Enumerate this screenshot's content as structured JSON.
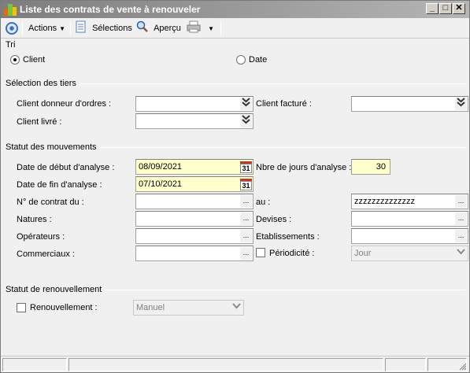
{
  "window": {
    "title": "Liste des contrats de vente à renouveler"
  },
  "window_controls": {
    "minimize": "_",
    "maximize": "□",
    "close": "✕"
  },
  "toolbar": {
    "actions_label": "Actions",
    "selections_label": "Sélections",
    "apercu_label": "Aperçu"
  },
  "tri": {
    "title": "Tri",
    "options": [
      {
        "label": "Client",
        "checked": true
      },
      {
        "label": "Date",
        "checked": false
      }
    ]
  },
  "tiers": {
    "title": "Sélection des tiers",
    "client_donneur_label": "Client donneur d'ordres :",
    "client_donneur_value": "",
    "client_facture_label": "Client facturé :",
    "client_facture_value": "",
    "client_livre_label": "Client livré :",
    "client_livre_value": ""
  },
  "mouvements": {
    "title": "Statut des mouvements",
    "date_debut_label": "Date de début d'analyse :",
    "date_debut_value": "08/09/2021",
    "nbre_jours_label": "Nbre de jours d'analyse :",
    "nbre_jours_value": "30",
    "date_fin_label": "Date de fin d'analyse :",
    "date_fin_value": "07/10/2021",
    "calendar_day": "31",
    "contrat_du_label": "N° de contrat du :",
    "contrat_du_value": "",
    "contrat_au_label": "au :",
    "contrat_au_value": "zzzzzzzzzzzzzz",
    "natures_label": "Natures :",
    "devises_label": "Devises :",
    "operateurs_label": "Opérateurs :",
    "etablissements_label": "Etablissements :",
    "commerciaux_label": "Commerciaux :",
    "periodicite_label": "Périodicité :",
    "periodicite_value": "Jour",
    "ellipsis": "..."
  },
  "renouvellement": {
    "title": "Statut de renouvellement",
    "label": "Renouvellement :",
    "value": "Manuel"
  },
  "colors": {
    "field_yellow": "#ffffcc",
    "titlebar": "#7d7d7d"
  }
}
